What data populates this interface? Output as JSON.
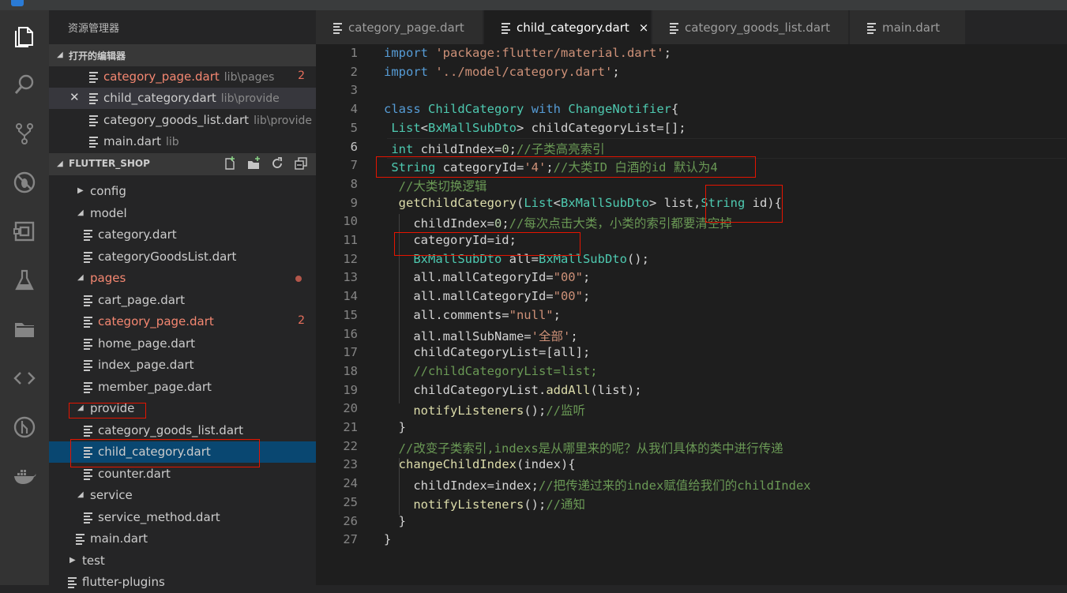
{
  "sidebar": {
    "title": "资源管理器",
    "open_editors_label": "打开的编辑器",
    "open_editors": [
      {
        "name": "category_page.dart",
        "path": "lib\\pages",
        "badge": "2"
      },
      {
        "name": "child_category.dart",
        "path": "lib\\provide"
      },
      {
        "name": "category_goods_list.dart",
        "path": "lib\\provide"
      },
      {
        "name": "main.dart",
        "path": "lib"
      }
    ],
    "project_label": "FLUTTER_SHOP",
    "tree": [
      {
        "label": "config"
      },
      {
        "label": "model"
      },
      {
        "label": "category.dart"
      },
      {
        "label": "categoryGoodsList.dart"
      },
      {
        "label": "pages"
      },
      {
        "label": "cart_page.dart"
      },
      {
        "label": "category_page.dart",
        "badge": "2"
      },
      {
        "label": "home_page.dart"
      },
      {
        "label": "index_page.dart"
      },
      {
        "label": "member_page.dart"
      },
      {
        "label": "provide"
      },
      {
        "label": "category_goods_list.dart"
      },
      {
        "label": "child_category.dart"
      },
      {
        "label": "counter.dart"
      },
      {
        "label": "service"
      },
      {
        "label": "service_method.dart"
      },
      {
        "label": "main.dart"
      },
      {
        "label": "test"
      },
      {
        "label": "flutter-plugins"
      }
    ]
  },
  "tabs": [
    {
      "label": "category_page.dart"
    },
    {
      "label": "child_category.dart",
      "close": "×"
    },
    {
      "label": "category_goods_list.dart"
    },
    {
      "label": "main.dart"
    }
  ],
  "editor": {
    "line_numbers": [
      "1",
      "2",
      "3",
      "4",
      "5",
      "6",
      "7",
      "8",
      "9",
      "10",
      "11",
      "12",
      "13",
      "14",
      "15",
      "16",
      "17",
      "18",
      "19",
      "20",
      "21",
      "22",
      "23",
      "24",
      "25",
      "26",
      "27"
    ],
    "lines": [
      [
        [
          "k",
          "import"
        ],
        [
          "v",
          " "
        ],
        [
          "s",
          "'package:flutter/material.dart'"
        ],
        [
          "v",
          ";"
        ]
      ],
      [
        [
          "k",
          "import"
        ],
        [
          "v",
          " "
        ],
        [
          "s",
          "'../model/category.dart'"
        ],
        [
          "v",
          ";"
        ]
      ],
      [],
      [
        [
          "k",
          "class"
        ],
        [
          "v",
          " "
        ],
        [
          "t",
          "ChildCategory"
        ],
        [
          "v",
          " "
        ],
        [
          "k",
          "with"
        ],
        [
          "v",
          " "
        ],
        [
          "t",
          "ChangeNotifier"
        ],
        [
          "v",
          "{"
        ]
      ],
      [
        [
          "v",
          " "
        ],
        [
          "t",
          "List"
        ],
        [
          "v",
          "<"
        ],
        [
          "t",
          "BxMallSubDto"
        ],
        [
          "v",
          "> childCategoryList=[];"
        ]
      ],
      [
        [
          "v",
          " "
        ],
        [
          "t",
          "int"
        ],
        [
          "v",
          " childIndex="
        ],
        [
          "n",
          "0"
        ],
        [
          "v",
          ";"
        ],
        [
          "c",
          "//子类高亮索引"
        ]
      ],
      [
        [
          "v",
          " "
        ],
        [
          "t",
          "String"
        ],
        [
          "v",
          " categoryId="
        ],
        [
          "s",
          "'4'"
        ],
        [
          "v",
          ";"
        ],
        [
          "c",
          "//大类ID 白酒的id 默认为4"
        ]
      ],
      [
        [
          "v",
          "  "
        ],
        [
          "c",
          "//大类切换逻辑"
        ]
      ],
      [
        [
          "v",
          "  "
        ],
        [
          "f",
          "getChildCategory"
        ],
        [
          "v",
          "("
        ],
        [
          "t",
          "List"
        ],
        [
          "v",
          "<"
        ],
        [
          "t",
          "BxMallSubDto"
        ],
        [
          "v",
          "> list,"
        ],
        [
          "t",
          "String"
        ],
        [
          "v",
          " id){"
        ]
      ],
      [
        [
          "v",
          "    childIndex="
        ],
        [
          "n",
          "0"
        ],
        [
          "v",
          ";"
        ],
        [
          "c",
          "//每次点击大类，小类的索引都要清空掉"
        ]
      ],
      [
        [
          "v",
          "    categoryId=id;"
        ]
      ],
      [
        [
          "v",
          "    "
        ],
        [
          "t",
          "BxMallSubDto"
        ],
        [
          "v",
          " all="
        ],
        [
          "t",
          "BxMallSubDto"
        ],
        [
          "v",
          "();"
        ]
      ],
      [
        [
          "v",
          "    all.mallCategoryId="
        ],
        [
          "s",
          "\"00\""
        ],
        [
          "v",
          ";"
        ]
      ],
      [
        [
          "v",
          "    all.mallCategoryId="
        ],
        [
          "s",
          "\"00\""
        ],
        [
          "v",
          ";"
        ]
      ],
      [
        [
          "v",
          "    all.comments="
        ],
        [
          "s",
          "\"null\""
        ],
        [
          "v",
          ";"
        ]
      ],
      [
        [
          "v",
          "    all.mallSubName="
        ],
        [
          "s",
          "'全部'"
        ],
        [
          "v",
          ";"
        ]
      ],
      [
        [
          "v",
          "    childCategoryList=[all];"
        ]
      ],
      [
        [
          "v",
          "    "
        ],
        [
          "c",
          "//childCategoryList=list;"
        ]
      ],
      [
        [
          "v",
          "    childCategoryList."
        ],
        [
          "f",
          "addAll"
        ],
        [
          "v",
          "(list);"
        ]
      ],
      [
        [
          "v",
          "    "
        ],
        [
          "f",
          "notifyListeners"
        ],
        [
          "v",
          "();"
        ],
        [
          "c",
          "//监听"
        ]
      ],
      [
        [
          "v",
          "  }"
        ]
      ],
      [
        [
          "v",
          "  "
        ],
        [
          "c",
          "//改变子类索引,indexs是从哪里来的呢？从我们具体的类中进行传递"
        ]
      ],
      [
        [
          "v",
          "  "
        ],
        [
          "f",
          "changeChildIndex"
        ],
        [
          "v",
          "(index){"
        ]
      ],
      [
        [
          "v",
          "    childIndex=index;"
        ],
        [
          "c",
          "//把传递过来的index赋值给我们的childIndex"
        ]
      ],
      [
        [
          "v",
          "    "
        ],
        [
          "f",
          "notifyListeners"
        ],
        [
          "v",
          "();"
        ],
        [
          "c",
          "//通知"
        ]
      ],
      [
        [
          "v",
          "  }"
        ]
      ],
      [
        [
          "v",
          "}"
        ]
      ]
    ]
  },
  "colors": {
    "accent": "#007acc",
    "selection": "#094771",
    "error": "#f48771",
    "annotation_box": "#e51400"
  }
}
